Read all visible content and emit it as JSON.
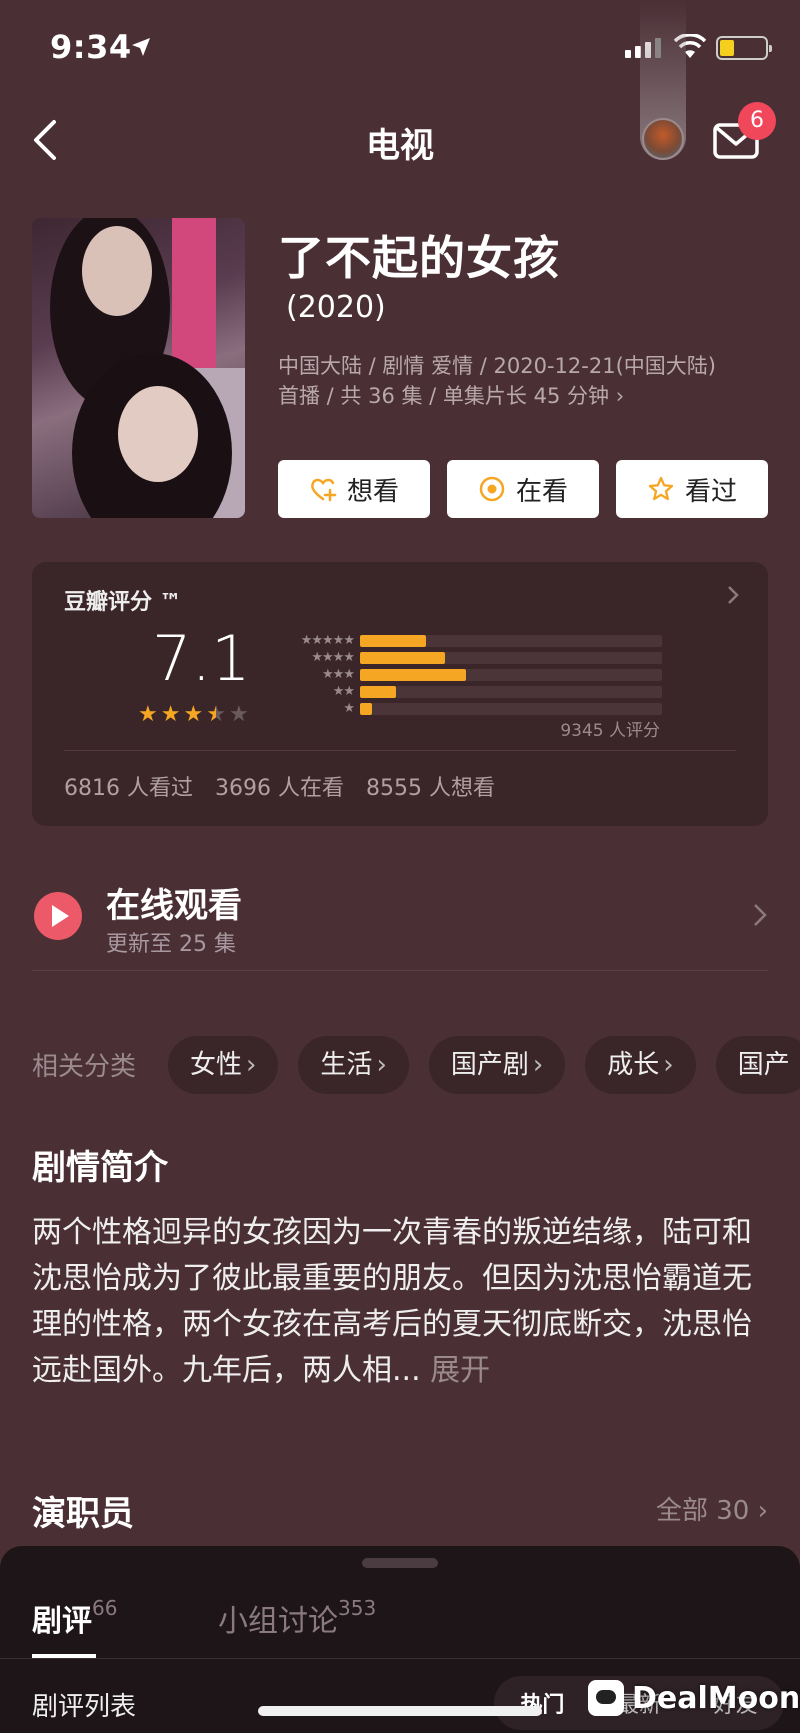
{
  "status_bar": {
    "time": "9:34"
  },
  "nav": {
    "title": "电视",
    "badge_count": "6"
  },
  "show": {
    "title": "了不起的女孩",
    "year": "(2020)",
    "meta_line1": "中国大陆 / 剧情 爱情 / 2020-12-21(中国大陆)",
    "meta_line2": "首播 / 共 36 集 / 单集片长 45 分钟",
    "meta_more": "›"
  },
  "actions": {
    "want": "想看",
    "watching": "在看",
    "watched": "看过"
  },
  "rating": {
    "label": "豆瓣评分 ™",
    "score": "7.1",
    "stars": 3.5,
    "distribution": [
      {
        "stars": "★★★★★",
        "fraction": 0.22
      },
      {
        "stars": "★★★★",
        "fraction": 0.28
      },
      {
        "stars": "★★★",
        "fraction": 0.35
      },
      {
        "stars": "★★",
        "fraction": 0.12
      },
      {
        "stars": "★",
        "fraction": 0.04
      }
    ],
    "count": "9345 人评分",
    "watched": "6816 人看过",
    "watching": "3696 人在看",
    "want": "8555 人想看",
    "accent_color": "#f5a623"
  },
  "online": {
    "title": "在线观看",
    "subtitle": "更新至 25 集"
  },
  "tags": {
    "label": "相关分类",
    "items": [
      "女性",
      "生活",
      "国产剧",
      "成长",
      "国产"
    ]
  },
  "synopsis": {
    "title": "剧情简介",
    "text": "两个性格迥异的女孩因为一次青春的叛逆结缘，陆可和沈思怡成为了彼此最重要的朋友。但因为沈思怡霸道无理的性格，两个女孩在高考后的夏天彻底断交，沈思怡远赴国外。九年后，两人相...",
    "more": "展开"
  },
  "cast": {
    "title": "演职员",
    "all": "全部 30 ›"
  },
  "sheet": {
    "tab_reviews": "剧评",
    "tab_reviews_count": "66",
    "tab_groups": "小组讨论",
    "tab_groups_count": "353",
    "list_label": "剧评列表",
    "sort_hot": "热门",
    "sort_new": "最新",
    "sort_friends": "好友"
  },
  "watermark": "DealMoon"
}
